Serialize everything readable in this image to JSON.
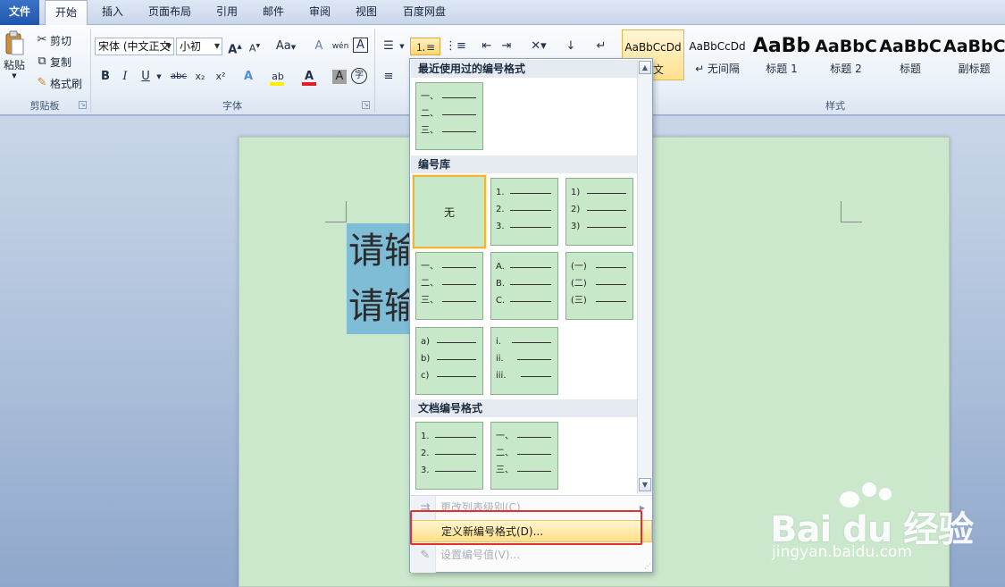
{
  "tabs": [
    "文件",
    "开始",
    "插入",
    "页面布局",
    "引用",
    "邮件",
    "审阅",
    "视图",
    "百度网盘"
  ],
  "clipboard": {
    "paste": "粘贴",
    "cut": "剪切",
    "copy": "复制",
    "format_painter": "格式刷",
    "group_label": "剪贴板"
  },
  "font": {
    "name": "宋体 (中文正文",
    "size": "小初",
    "group_label": "字体",
    "bold": "B",
    "italic": "I",
    "underline": "U",
    "strike": "abc",
    "grow": "A",
    "shrink": "A",
    "case": "Aa",
    "clear": "A",
    "pinyin": "wén",
    "border_char": "A",
    "color_letter": "A",
    "shade_letter": "A",
    "circle_char": "字"
  },
  "styles": {
    "group_label": "样式",
    "items": [
      {
        "sample": "AaBbCcDd",
        "name": "正文"
      },
      {
        "sample": "AaBbCcDd",
        "name": "↵ 无间隔"
      },
      {
        "sample": "AaBb",
        "name": "标题 1"
      },
      {
        "sample": "AaBbC",
        "name": "标题 2"
      },
      {
        "sample": "AaBbC",
        "name": "标题"
      },
      {
        "sample": "AaBbC",
        "name": "副标题"
      }
    ]
  },
  "document": {
    "line1": "请输",
    "line2": "请输"
  },
  "numbering_dropdown": {
    "recent_header": "最近使用过的编号格式",
    "library_header": "编号库",
    "document_header": "文档编号格式",
    "recent": [
      {
        "rows": [
          "一、",
          "二、",
          "三、"
        ]
      }
    ],
    "library": [
      {
        "none": "无"
      },
      {
        "rows": [
          "1.",
          "2.",
          "3."
        ]
      },
      {
        "rows": [
          "1)",
          "2)",
          "3)"
        ]
      },
      {
        "rows": [
          "一、",
          "二、",
          "三、"
        ]
      },
      {
        "rows": [
          "A.",
          "B.",
          "C."
        ]
      },
      {
        "rows": [
          "(一)",
          "(二)",
          "(三)"
        ]
      },
      {
        "rows": [
          "a)",
          "b)",
          "c)"
        ]
      },
      {
        "rows": [
          "i.",
          "ii.",
          "iii."
        ]
      }
    ],
    "document_formats": [
      {
        "rows": [
          "1.",
          "2.",
          "3."
        ]
      },
      {
        "rows": [
          "一、",
          "二、",
          "三、"
        ]
      }
    ],
    "menu": [
      {
        "label": "更改列表级别(C)",
        "icon": "indent-icon",
        "enabled": false,
        "submenu": true
      },
      {
        "label": "定义新编号格式(D)...",
        "icon": "",
        "enabled": true,
        "highlighted": true
      },
      {
        "label": "设置编号值(V)...",
        "icon": "set-value-icon",
        "enabled": false
      }
    ]
  },
  "watermark": {
    "brand": "Bai du 经验",
    "url": "jingyan.baidu.com"
  },
  "colors": {
    "page": "#cbe8cc",
    "tile": "#c7e9c9",
    "selection": "#7fbcd6",
    "highlight_border": "#e2312e"
  }
}
